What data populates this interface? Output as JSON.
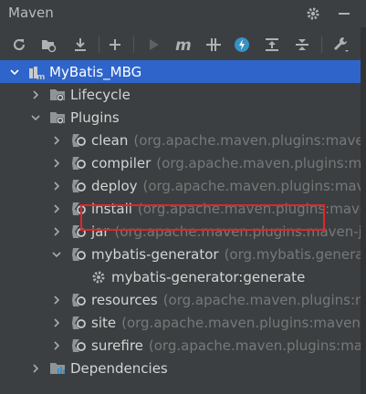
{
  "window": {
    "title": "Maven"
  },
  "tree": {
    "root": "MyBatis_MBG",
    "lifecycle": "Lifecycle",
    "plugins": "Plugins",
    "plugin_items": [
      {
        "name": "clean",
        "group": "(org.apache.maven.plugins:maven"
      },
      {
        "name": "compiler",
        "group": "(org.apache.maven.plugins:ma"
      },
      {
        "name": "deploy",
        "group": "(org.apache.maven.plugins:mave"
      },
      {
        "name": "install",
        "group": "(org.apache.maven.plugins:maver"
      },
      {
        "name": "jar",
        "group": "(org.apache.maven.plugins:maven-jar"
      },
      {
        "name": "mybatis-generator",
        "group": "(org.mybatis.generat"
      },
      {
        "name": "resources",
        "group": "(org.apache.maven.plugins:m"
      },
      {
        "name": "site",
        "group": "(org.apache.maven.plugins:maven-s"
      },
      {
        "name": "surefire",
        "group": "(org.apache.maven.plugins:mav"
      }
    ],
    "goal": "mybatis-generator:generate",
    "dependencies": "Dependencies"
  },
  "colors": {
    "selection": "#2f65ca",
    "highlight_box": "#e0262a",
    "background": "#3c3f41"
  }
}
